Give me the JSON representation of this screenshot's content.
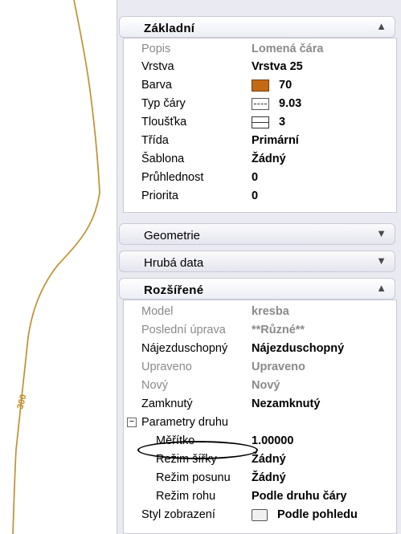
{
  "canvas": {
    "contour_label": "300",
    "contour_color": "#c8891e"
  },
  "sections": {
    "zakladni": {
      "title": "Základní",
      "state": "expanded"
    },
    "geometrie": {
      "title": "Geometrie",
      "state": "collapsed"
    },
    "hruba_data": {
      "title": "Hrubá data",
      "state": "collapsed"
    },
    "rozsirene": {
      "title": "Rozšířené",
      "state": "expanded"
    }
  },
  "zakladni_rows": [
    {
      "label": "Popis",
      "value": "Lomená čára"
    },
    {
      "label": "Vrstva",
      "value": "Vrstva 25"
    },
    {
      "label": "Barva",
      "value": "70"
    },
    {
      "label": "Typ čáry",
      "value": "9.03"
    },
    {
      "label": "Tloušťka",
      "value": "3"
    },
    {
      "label": "Třída",
      "value": "Primární"
    },
    {
      "label": "Šablona",
      "value": "Žádný"
    },
    {
      "label": "Průhlednost",
      "value": "0"
    },
    {
      "label": "Priorita",
      "value": "0"
    }
  ],
  "rozsirene_rows": [
    {
      "label": "Model",
      "value": "kresba"
    },
    {
      "label": "Poslední úprava",
      "value": "**Různé**"
    },
    {
      "label": "Nájezduschopný",
      "value": "Nájezduschopný"
    },
    {
      "label": "Upraveno",
      "value": "Upraveno"
    },
    {
      "label": "Nový",
      "value": "Nový"
    },
    {
      "label": "Zamknutý",
      "value": "Nezamknutý"
    },
    {
      "label": "Parametry druhu",
      "value": ""
    },
    {
      "label": "Měřítko",
      "value": "1.00000"
    },
    {
      "label": "Režim šířky",
      "value": "Žádný"
    },
    {
      "label": "Režim posunu",
      "value": "Žádný"
    },
    {
      "label": "Režim rohu",
      "value": "Podle druhu čáry"
    },
    {
      "label": "Styl zobrazení",
      "value": "Podle pohledu"
    }
  ],
  "icons": {
    "expanded": "chevron-up-icon",
    "collapsed": "chevron-down-icon",
    "group": "minus-box-icon"
  },
  "colors": {
    "barva_swatch": "#c46a14",
    "panel_bg": "#e9eaf2"
  }
}
